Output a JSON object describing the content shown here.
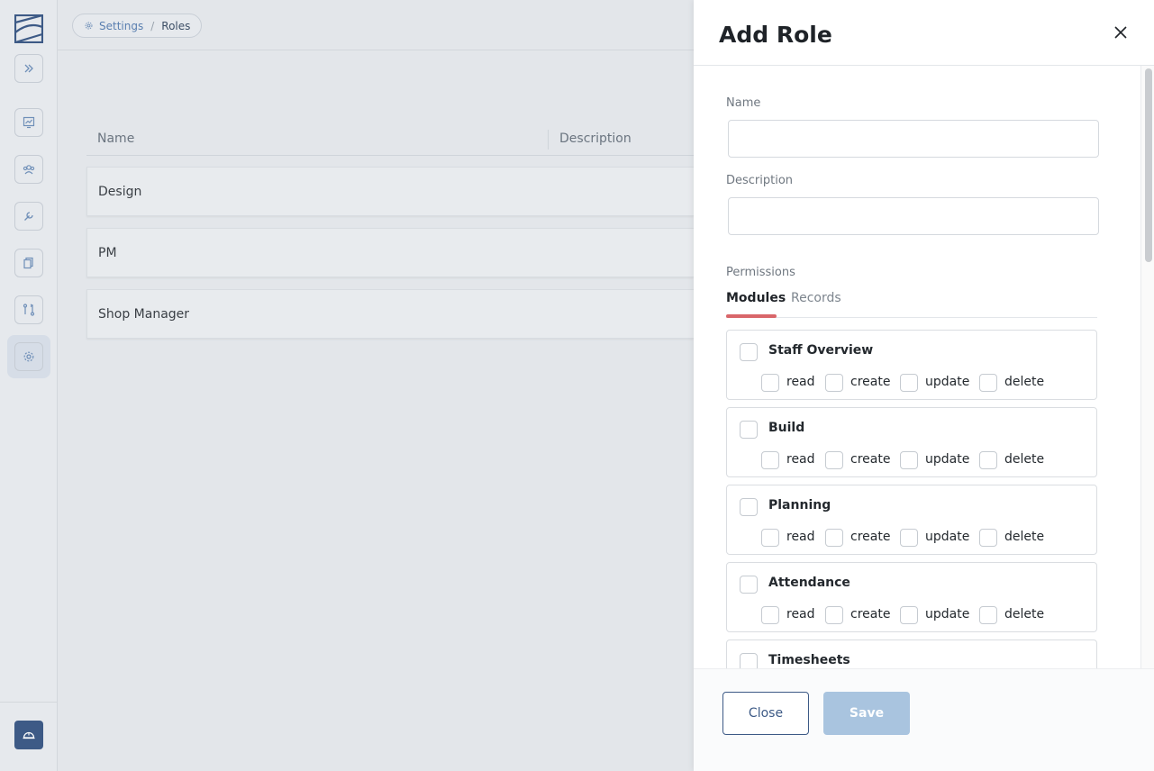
{
  "breadcrumb": {
    "root": "Settings",
    "separator": "/",
    "current": "Roles"
  },
  "table": {
    "columns": {
      "name": "Name",
      "description": "Description"
    },
    "rows": [
      {
        "name": "Design"
      },
      {
        "name": "PM"
      },
      {
        "name": "Shop Manager"
      }
    ]
  },
  "drawer": {
    "title": "Add Role",
    "name_label": "Name",
    "name_value": "",
    "description_label": "Description",
    "description_value": "",
    "permissions_label": "Permissions",
    "tabs": {
      "modules": "Modules",
      "records": "Records"
    },
    "permission_labels": {
      "read": "read",
      "create": "create",
      "update": "update",
      "delete": "delete"
    },
    "modules": [
      {
        "name": "Staff Overview"
      },
      {
        "name": "Build"
      },
      {
        "name": "Planning"
      },
      {
        "name": "Attendance"
      },
      {
        "name": "Timesheets"
      }
    ],
    "close_label": "Close",
    "save_label": "Save"
  },
  "colors": {
    "accent": "#3d5a86",
    "tab_underline": "#d9666a",
    "save_disabled": "#a9c4df"
  }
}
